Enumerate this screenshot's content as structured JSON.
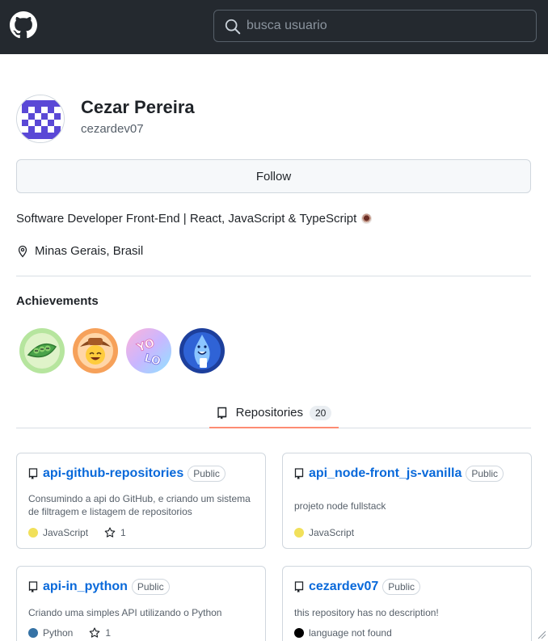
{
  "header": {
    "search_placeholder": "busca usuario"
  },
  "profile": {
    "name": "Cezar Pereira",
    "login": "cezardev07",
    "follow_label": "Follow",
    "bio": "Software Developer Front-End | React, JavaScript & TypeScript",
    "location": "Minas Gerais, Brasil"
  },
  "achievements": {
    "title": "Achievements",
    "badges": [
      "pair-extraordinaire-badge",
      "quickdraw-badge",
      "yolo-badge",
      "pull-shark-badge"
    ]
  },
  "tabs": {
    "repositories_label": "Repositories",
    "repositories_count": "20"
  },
  "repos": [
    {
      "name": "api-github-repositories",
      "visibility": "Public",
      "description": "Consumindo a api do GitHub, e criando um sistema de filtragem e listagem de repositorios",
      "language": "JavaScript",
      "language_color": "#f1e05a",
      "stars": "1"
    },
    {
      "name": "api_node-front_js-vanilla",
      "visibility": "Public",
      "description": "projeto node fullstack",
      "language": "JavaScript",
      "language_color": "#f1e05a"
    },
    {
      "name": "api-in_python",
      "visibility": "Public",
      "description": "Criando uma simples API utilizando o Python",
      "language": "Python",
      "language_color": "#3572A5",
      "stars": "1"
    },
    {
      "name": "cezardev07",
      "visibility": "Public",
      "description": "this repository has no description!",
      "language": "language not found",
      "language_color": "#000000"
    }
  ],
  "colors": {
    "header_bg": "#24292f",
    "link": "#0969da",
    "tab_underline": "#fd8c73"
  }
}
